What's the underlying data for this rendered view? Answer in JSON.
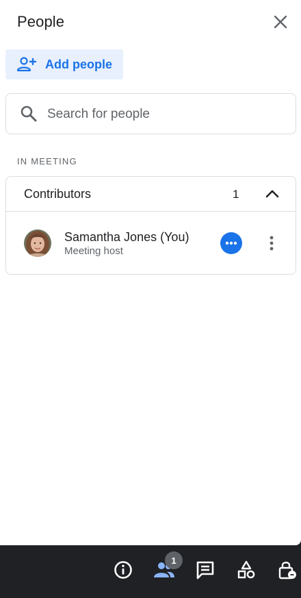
{
  "panel": {
    "title": "People",
    "close_icon": "close-icon",
    "add_people": {
      "label": "Add people",
      "icon": "person-add-icon"
    },
    "search": {
      "placeholder": "Search for people",
      "value": "",
      "icon": "search-icon"
    },
    "section_label": "IN MEETING",
    "groups": [
      {
        "name": "Contributors",
        "count": "1",
        "expanded": true,
        "people": [
          {
            "name": "Samantha Jones (You)",
            "role": "Meeting host",
            "avatar": "avatar-photo"
          }
        ]
      }
    ]
  },
  "toolbar": {
    "people_badge": "1",
    "buttons": [
      "info-icon",
      "people-icon",
      "chat-icon",
      "activities-icon",
      "host-controls-icon"
    ]
  },
  "colors": {
    "accent": "#1a73e8",
    "accent_light": "#e8f0fe",
    "toolbar_bg": "#202124",
    "active_people": "#8ab4f8",
    "border": "#dadce0"
  }
}
